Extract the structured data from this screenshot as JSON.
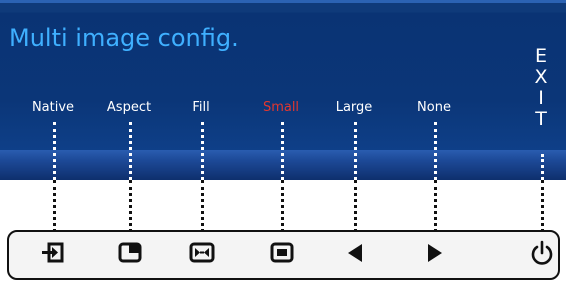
{
  "osd": {
    "title": "Multi image config.",
    "options": [
      {
        "label": "Native",
        "active": false
      },
      {
        "label": "Aspect",
        "active": false
      },
      {
        "label": "Fill",
        "active": false
      },
      {
        "label": "Small",
        "active": true
      },
      {
        "label": "Large",
        "active": false
      },
      {
        "label": "None",
        "active": false
      }
    ],
    "exit": [
      "E",
      "X",
      "I",
      "T"
    ]
  },
  "buttons": [
    {
      "icon": "input-source-icon"
    },
    {
      "icon": "aspect-window-icon"
    },
    {
      "icon": "fill-screen-icon"
    },
    {
      "icon": "small-window-icon"
    },
    {
      "icon": "left-arrow-icon"
    },
    {
      "icon": "right-arrow-icon"
    },
    {
      "icon": "power-icon"
    }
  ],
  "colors": {
    "panel": "#0b3678",
    "title": "#3fb0ff",
    "active_option": "#e2372f",
    "text": "#ffffff"
  }
}
